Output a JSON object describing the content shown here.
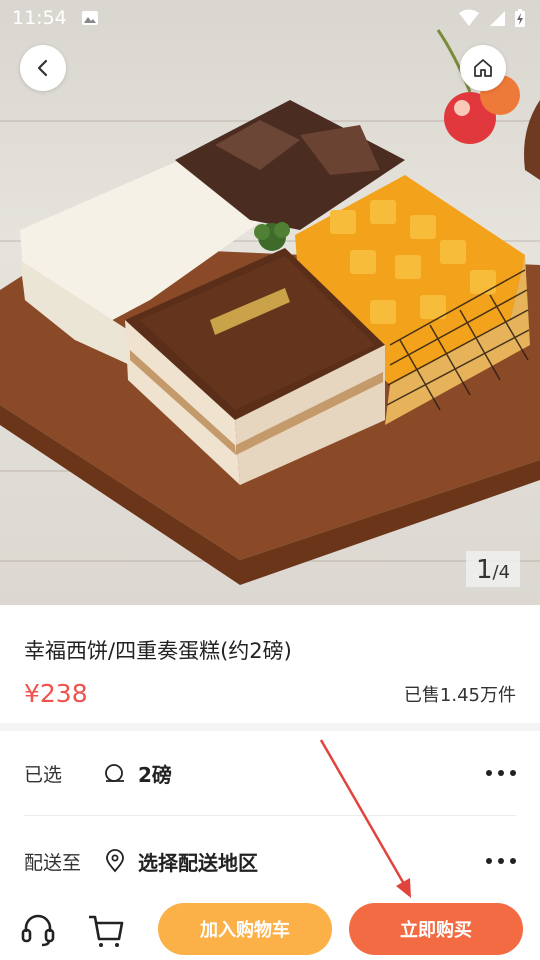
{
  "status": {
    "time": "11:54"
  },
  "hero": {
    "image_desc": "cake",
    "counter_current": "1",
    "counter_total": "/4",
    "back_icon": "chevron-left-icon",
    "home_icon": "home-icon"
  },
  "product": {
    "title": "幸福西饼/四重奏蛋糕(约2磅)",
    "price": "¥238",
    "sold": "已售1.45万件"
  },
  "options": {
    "selected_label": "已选",
    "selected_value": "2磅",
    "delivery_label": "配送至",
    "delivery_value": "选择配送地区"
  },
  "bottom": {
    "add_cart": "加入购物车",
    "buy_now": "立即购买"
  },
  "colors": {
    "price": "#f0524e",
    "add_cart_bg": "#fbb048",
    "buy_now_bg": "#f36b43",
    "annotation_arrow": "#e0443c"
  }
}
